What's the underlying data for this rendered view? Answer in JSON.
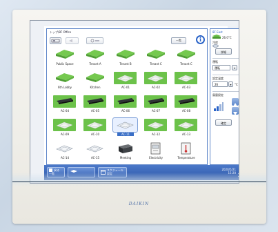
{
  "location_title": "トップ/8F Office",
  "toolbar": {
    "list_view_label": "一覧",
    "info_label": "i"
  },
  "units": [
    {
      "name": "Public Space",
      "type": "ceiling-green"
    },
    {
      "name": "Tenant A",
      "type": "ceiling-green"
    },
    {
      "name": "Tenant B",
      "type": "ceiling-green"
    },
    {
      "name": "Tenant C",
      "type": "ceiling-green"
    },
    {
      "name": "Tenant C",
      "type": "ceiling-green"
    },
    {
      "name": "6th Lobby",
      "type": "ceiling-green"
    },
    {
      "name": "Kitchen",
      "type": "ceiling-green"
    },
    {
      "name": "AC-01",
      "type": "cassette-green"
    },
    {
      "name": "AC-02",
      "type": "cassette-green"
    },
    {
      "name": "AC-03",
      "type": "cassette-green"
    },
    {
      "name": "AC-04",
      "type": "wall-green"
    },
    {
      "name": "AC-05",
      "type": "wall-green"
    },
    {
      "name": "AC-06",
      "type": "wall-green"
    },
    {
      "name": "AC-07",
      "type": "wall-green"
    },
    {
      "name": "AC-08",
      "type": "wall-green"
    },
    {
      "name": "AC-09",
      "type": "cassette-green"
    },
    {
      "name": "AC-10",
      "type": "cassette-green"
    },
    {
      "name": "AC-11",
      "type": "cassette-white",
      "selected": true
    },
    {
      "name": "AC-12",
      "type": "cassette-green"
    },
    {
      "name": "AC-13",
      "type": "cassette-green"
    },
    {
      "name": "AC-14",
      "type": "cassette-white"
    },
    {
      "name": "AC-15",
      "type": "cassette-white"
    },
    {
      "name": "Meeting",
      "type": "box-dark"
    },
    {
      "name": "Electricity",
      "type": "meter"
    },
    {
      "name": "Temperature",
      "type": "thermo"
    }
  ],
  "right_panel": {
    "area_label": "8F East",
    "temp": "26.0°C",
    "mode_label": "冷房",
    "detail_button": "詳細",
    "operation_label": "運転",
    "operation_value": "運転",
    "setpoint_label": "設定温度",
    "setpoint_value": "26",
    "setpoint_unit": "°C",
    "fan_label": "風量設定",
    "ok_button": "確定"
  },
  "taskbar": {
    "btn1": "戻る 一覧",
    "btn2": "",
    "btn3": "スケジュール 設定",
    "clock_date": "2020/5/21",
    "clock_time": "15:20"
  },
  "brand": "DAIKIN",
  "colors": {
    "green": "#6cc24a",
    "accent_blue": "#2b64c8",
    "taskbar": "#3a66b8"
  }
}
